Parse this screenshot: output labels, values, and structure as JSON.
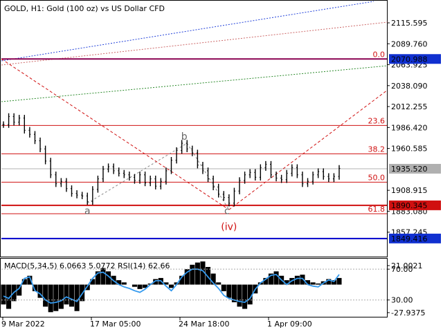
{
  "header": {
    "title": "GOLD, H1:  Gold (100 oz) vs US Dollar CFD",
    "indicator_label": "MACD(5,34,5) 6.0663 5.0772 RSI(14) 62.66"
  },
  "colors": {
    "fib": "#d01010",
    "price_bars": "#000000",
    "blue_line": "#0000cc",
    "purple_line": "#8a0050",
    "current_price": "#b0b0b0",
    "tag_bg": "#1030d0",
    "tag_red": "#d01010",
    "macd_hist": "#000000",
    "rsi": "#3399ee",
    "channel_blue": "#1f3fd9",
    "channel_red": "#c04040",
    "channel_green": "#2a8a2a"
  },
  "chart_data": [
    {
      "type": "line",
      "title": "GOLD, H1:  Gold (100 oz) vs US Dollar CFD",
      "x_tick_labels": [
        "9 Mar 2022",
        "17 Mar 05:00",
        "24 Mar 18:00",
        "1 Apr 09:00"
      ],
      "y_tick_labels": [
        "2115.595",
        "2089.760",
        "2063.925",
        "2038.090",
        "2012.255",
        "1986.420",
        "1960.585",
        "1908.915",
        "1883.080",
        "1857.245"
      ],
      "ylim": [
        1845,
        2125
      ],
      "price_tags": [
        "2070.988",
        "1935.520",
        "1890.345",
        "1849.416"
      ],
      "current_price": 1935.52,
      "fib_levels": [
        {
          "label": "0.0",
          "price": 2070.988
        },
        {
          "label": "23.6",
          "price": 1989.0
        },
        {
          "label": "38.2",
          "price": 1954.0
        },
        {
          "label": "50.0",
          "price": 1919.0
        },
        {
          "label": "61.8",
          "price": 1880.0
        }
      ],
      "support_line": 1849.416,
      "resistance_line": 2070.988,
      "strong_level": 1890.345,
      "wave_labels": [
        {
          "label": "a",
          "price": 1883.0
        },
        {
          "label": "b",
          "price": 1973.0
        },
        {
          "label": "c",
          "price": 1883.0
        },
        {
          "label": "(iv)",
          "price": 1872.0
        }
      ],
      "series": [
        {
          "values": [
            1990,
            2000,
            1993,
            1998,
            1983,
            1978,
            1970,
            1960,
            1945,
            1928,
            1917,
            1920,
            1911,
            1905,
            1903,
            1902,
            1895,
            1910,
            1923,
            1935,
            1938,
            1933,
            1930,
            1928,
            1925,
            1921,
            1928,
            1918,
            1923,
            1914,
            1920,
            1933,
            1946,
            1958,
            1967,
            1960,
            1955,
            1940,
            1933,
            1923,
            1913,
            1904,
            1900,
            1893,
            1908,
            1921,
            1928,
            1931,
            1925,
            1937,
            1941,
            1928,
            1924,
            1922,
            1930,
            1937,
            1928,
            1917,
            1920,
            1928,
            1932,
            1926,
            1923,
            1926,
            1936
          ]
        }
      ]
    },
    {
      "type": "bar",
      "title": "MACD(5,34,5) 6.0663 5.0772 RSI(14) 62.66",
      "y_tick_labels": [
        "21.0021",
        "70.00",
        "30.00",
        "-27.9375"
      ],
      "series": [
        {
          "name": "MACD",
          "values": [
            -18,
            -22,
            -15,
            -10,
            5,
            8,
            -6,
            -12,
            -20,
            -25,
            -24,
            -22,
            -18,
            -20,
            -24,
            -15,
            -5,
            5,
            12,
            15,
            12,
            8,
            4,
            2,
            0,
            -2,
            -4,
            -3,
            1,
            5,
            6,
            2,
            -3,
            2,
            8,
            14,
            18,
            20,
            21,
            16,
            10,
            2,
            -6,
            -12,
            -16,
            -20,
            -22,
            -18,
            -8,
            2,
            6,
            10,
            12,
            8,
            4,
            6,
            8,
            9,
            4,
            2,
            1,
            3,
            5,
            4,
            6
          ]
        },
        {
          "name": "RSI",
          "values": [
            35,
            32,
            40,
            45,
            58,
            60,
            42,
            38,
            30,
            26,
            27,
            29,
            34,
            31,
            28,
            38,
            48,
            58,
            65,
            66,
            61,
            55,
            50,
            47,
            45,
            42,
            40,
            44,
            50,
            55,
            55,
            48,
            42,
            50,
            60,
            66,
            70,
            70,
            68,
            60,
            52,
            45,
            36,
            32,
            30,
            28,
            27,
            32,
            44,
            52,
            57,
            62,
            63,
            56,
            50,
            55,
            58,
            58,
            50,
            48,
            47,
            52,
            56,
            54,
            63
          ]
        }
      ]
    }
  ]
}
